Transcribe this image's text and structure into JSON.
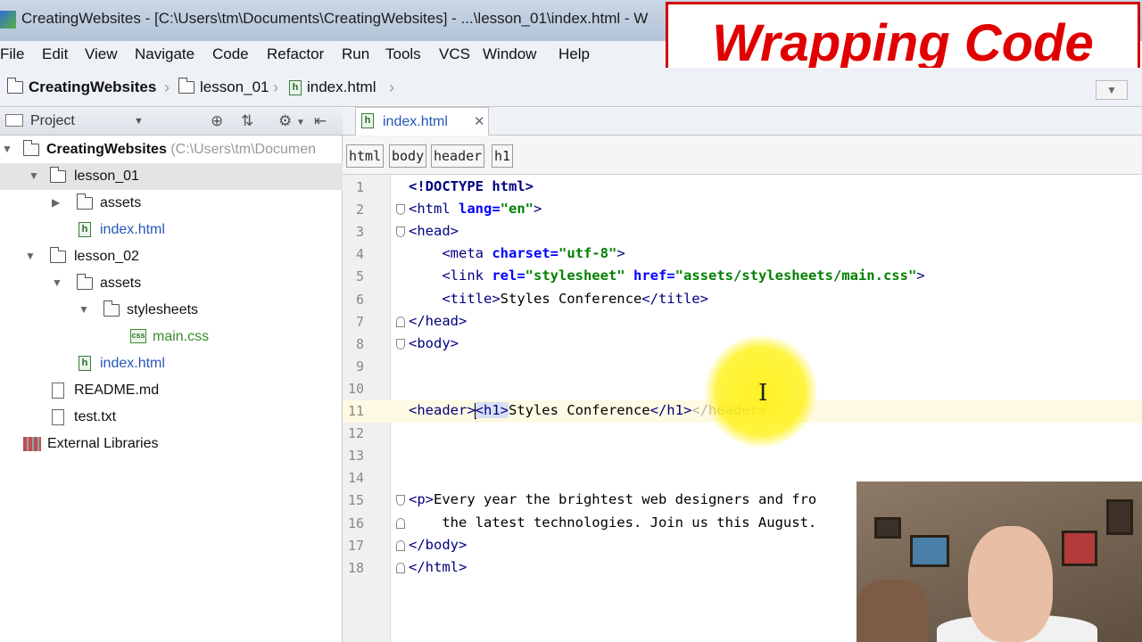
{
  "window": {
    "title": "CreatingWebsites - [C:\\Users\\tm\\Documents\\CreatingWebsites] - ...\\lesson_01\\index.html - W"
  },
  "banner": {
    "text": "Wrapping Code"
  },
  "menu": [
    "File",
    "Edit",
    "View",
    "Navigate",
    "Code",
    "Refactor",
    "Run",
    "Tools",
    "VCS",
    "Window",
    "Help"
  ],
  "breadcrumbs": [
    "CreatingWebsites",
    "lesson_01",
    "index.html"
  ],
  "project_panel": {
    "title": "Project",
    "tree": [
      {
        "label": "CreatingWebsites",
        "hint": "(C:\\Users\\tm\\Documen",
        "type": "folder",
        "depth": 0,
        "expanded": true
      },
      {
        "label": "lesson_01",
        "type": "folder",
        "depth": 1,
        "expanded": true,
        "selected": true
      },
      {
        "label": "assets",
        "type": "folder",
        "depth": 2,
        "expanded": false
      },
      {
        "label": "index.html",
        "type": "html",
        "depth": 2
      },
      {
        "label": "lesson_02",
        "type": "folder",
        "depth": 1,
        "expanded": true
      },
      {
        "label": "assets",
        "type": "folder",
        "depth": 2,
        "expanded": true
      },
      {
        "label": "stylesheets",
        "type": "folder",
        "depth": 3,
        "expanded": true
      },
      {
        "label": "main.css",
        "type": "css",
        "depth": 4
      },
      {
        "label": "index.html",
        "type": "html",
        "depth": 2
      },
      {
        "label": "README.md",
        "type": "doc",
        "depth": 1
      },
      {
        "label": "test.txt",
        "type": "doc",
        "depth": 1
      },
      {
        "label": "External Libraries",
        "type": "lib",
        "depth": 0
      }
    ]
  },
  "editor": {
    "tab_label": "index.html",
    "tag_path": [
      "html",
      "body",
      "header",
      "h1"
    ],
    "current_line": 11,
    "lines": [
      {
        "n": "1",
        "html": "<span class='kw'>&lt;!DOCTYPE </span><span class='kw'>html</span><span class='kw'>&gt;</span>"
      },
      {
        "n": "2",
        "html": "<span class='tag'>&lt;html </span><span class='attr'>lang=</span><span class='val'>\"en\"</span><span class='tag'>&gt;</span>",
        "fold": "start"
      },
      {
        "n": "3",
        "html": "<span class='tag'>&lt;head&gt;</span>",
        "fold": "start"
      },
      {
        "n": "4",
        "html": "    <span class='tag'>&lt;meta </span><span class='attr'>charset=</span><span class='val'>\"utf-8\"</span><span class='tag'>&gt;</span>"
      },
      {
        "n": "5",
        "html": "    <span class='tag'>&lt;link </span><span class='attr'>rel=</span><span class='val'>\"stylesheet\"</span> <span class='attr'>href=</span><span class='val'>\"assets/stylesheets/main.css\"</span><span class='tag'>&gt;</span>"
      },
      {
        "n": "6",
        "html": "    <span class='tag'>&lt;title&gt;</span>Styles Conference<span class='tag'>&lt;/title&gt;</span>"
      },
      {
        "n": "7",
        "html": "<span class='tag'>&lt;/head&gt;</span>",
        "fold": "end"
      },
      {
        "n": "8",
        "html": "<span class='tag'>&lt;body&gt;</span>",
        "fold": "start"
      },
      {
        "n": "9",
        "html": ""
      },
      {
        "n": "10",
        "html": ""
      },
      {
        "n": "11",
        "html": "<span class='tag'>&lt;header&gt;</span><span class='caret'></span><span class='tag highlight-word'>&lt;h1&gt;</span>Styles Conference<span class='tag'>&lt;/h1&gt;</span><span class='dim'>&lt;/header&gt;</span>"
      },
      {
        "n": "12",
        "html": ""
      },
      {
        "n": "13",
        "html": ""
      },
      {
        "n": "14",
        "html": ""
      },
      {
        "n": "15",
        "html": "<span class='tag'>&lt;p&gt;</span>Every year the brightest web designers and fro",
        "fold": "start"
      },
      {
        "n": "16",
        "html": "    the latest technologies. Join us this August.",
        "fold": "end"
      },
      {
        "n": "17",
        "html": "<span class='tag'>&lt;/body&gt;</span>",
        "fold": "end"
      },
      {
        "n": "18",
        "html": "<span class='tag'>&lt;/html&gt;</span>",
        "fold": "end"
      }
    ]
  }
}
